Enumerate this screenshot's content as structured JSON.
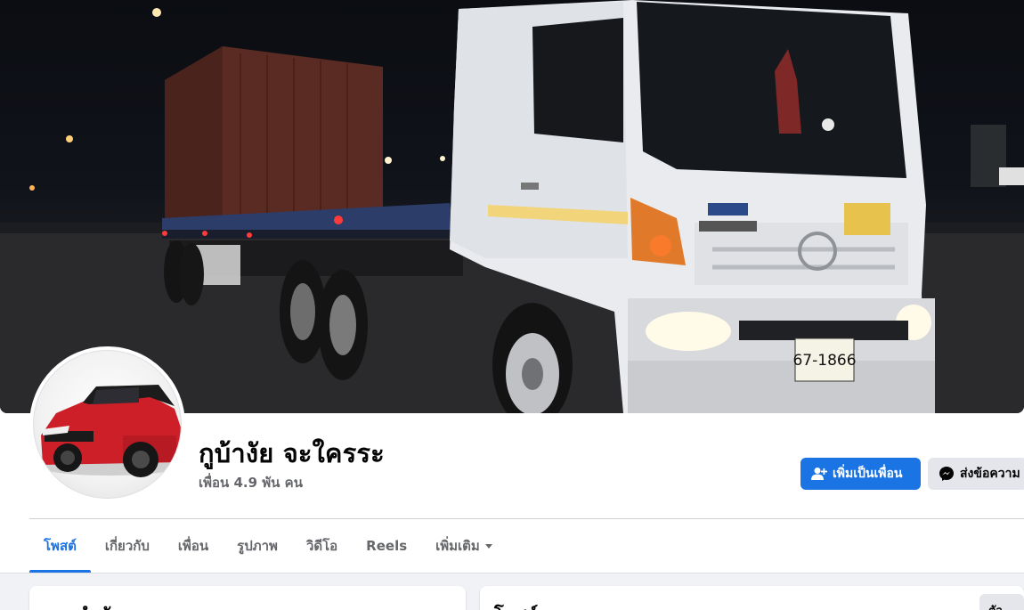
{
  "profile": {
    "name": "กูบ้างัย จะใครระ",
    "friends_count_text": "เพื่อน 4.9 พัน คน",
    "cover_photo_desc": "cover-photo",
    "license_plate": "67-1866"
  },
  "actions": {
    "add_friend_label": "เพิ่มเป็นเพื่อน",
    "message_label": "ส่งข้อความ"
  },
  "tabs": [
    {
      "label": "โพสต์",
      "active": true
    },
    {
      "label": "เกี่ยวกับ",
      "active": false
    },
    {
      "label": "เพื่อน",
      "active": false
    },
    {
      "label": "รูปภาพ",
      "active": false
    },
    {
      "label": "วิดีโอ",
      "active": false
    },
    {
      "label": "Reels",
      "active": false
    },
    {
      "label": "เพิ่มเติม",
      "active": false
    }
  ],
  "panels": {
    "intro_title": "แนะนำตัว",
    "posts_title": "โพสต์",
    "filter_label": "ตัวกรอง"
  },
  "colors": {
    "accent": "#1b74e4",
    "secondary_button": "#e4e6eb",
    "muted_text": "#65676b",
    "page_background": "#f0f2f5"
  },
  "icons": {
    "add_friend": "add-friend-icon",
    "messenger": "messenger-icon",
    "dropdown": "chevron-down-icon"
  }
}
